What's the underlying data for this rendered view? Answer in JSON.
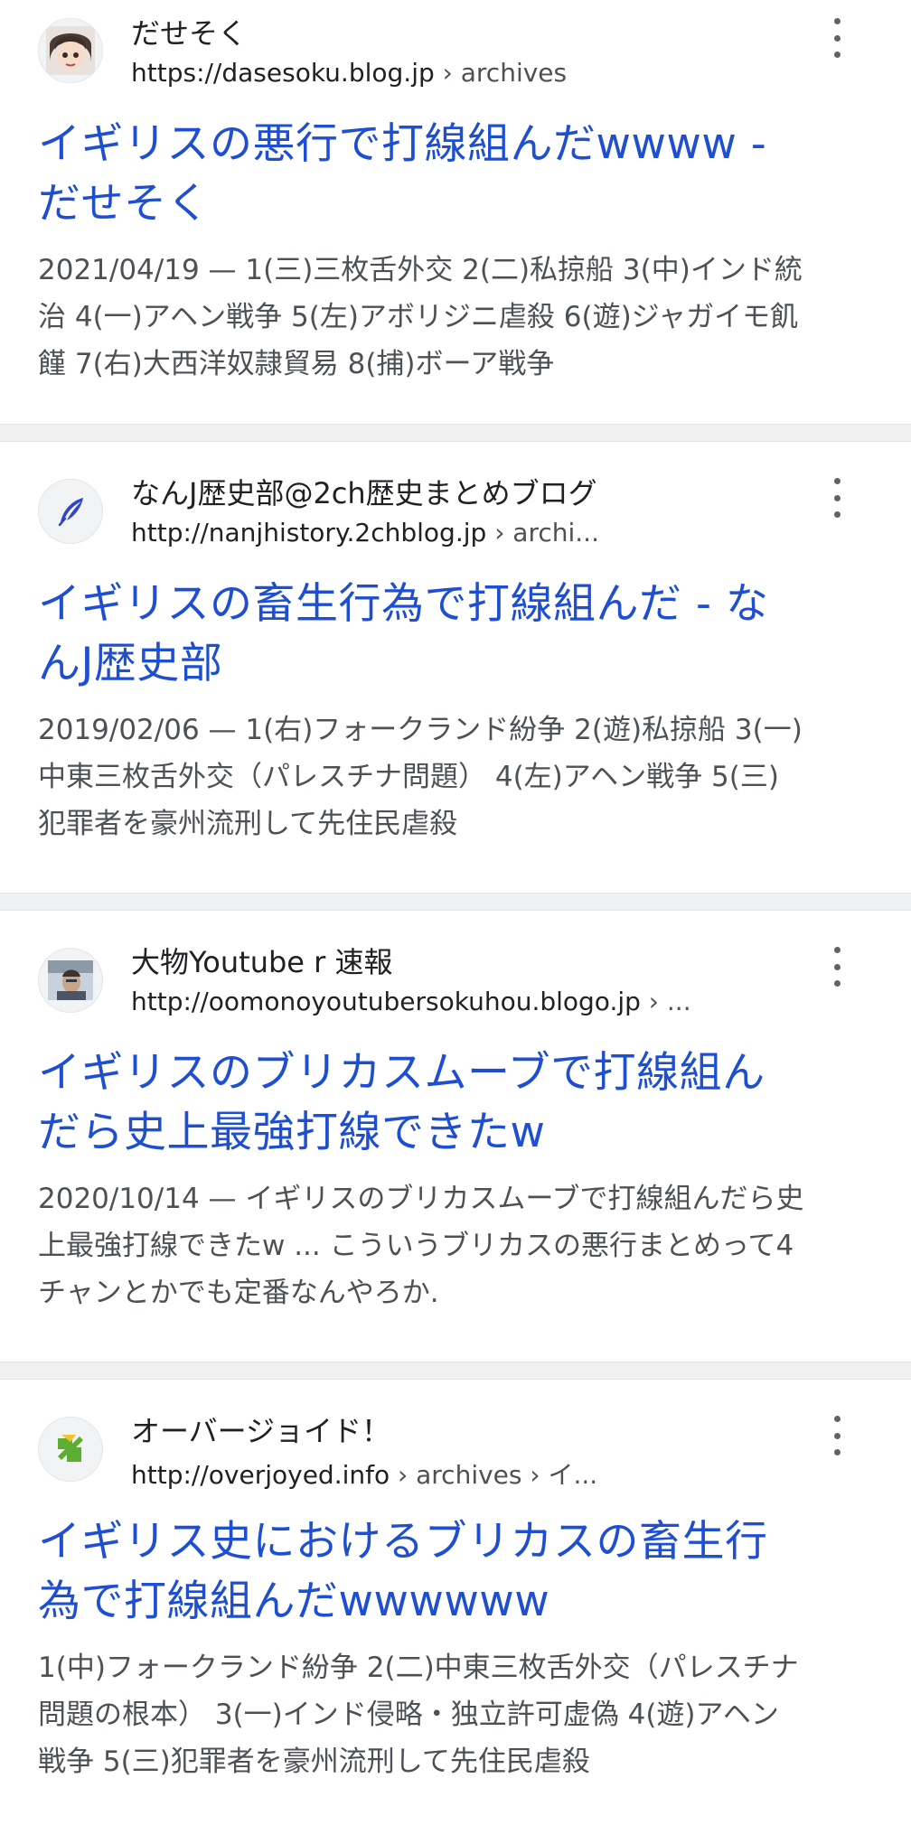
{
  "results": [
    {
      "site": "だせそく",
      "url_host": "https://dasesoku.blog.jp",
      "url_path": " › archives",
      "favicon": "anime-face-icon",
      "title_line1": "イギリスの悪行で打線組んだwwww -",
      "title_line2": "だせそく",
      "snippet_line1": "2021/04/19 — 1(三)三枚舌外交 2(二)私掠船 3(中)インド統",
      "snippet_line2": "治 4(一)アヘン戦争 5(左)アボリジニ虐殺 6(遊)ジャガイモ飢",
      "snippet_line3": "饉 7(右)大西洋奴隷貿易 8(捕)ボーア戦争"
    },
    {
      "site": "なんJ歴史部@2ch歴史まとめブログ",
      "url_host": "http://nanjhistory.2chblog.jp",
      "url_path": " › archi...",
      "favicon": "quill-icon",
      "title_line1": "イギリスの畜生行為で打線組んだ - な",
      "title_line2": "んJ歴史部",
      "snippet_line1": "2019/02/06 — 1(右)フォークランド紛争 2(遊)私掠船 3(一)",
      "snippet_line2": "中東三枚舌外交（パレスチナ問題） 4(左)アヘン戦争 5(三)",
      "snippet_line3": "犯罪者を豪州流刑して先住民虐殺"
    },
    {
      "site": "大物Youtube r 速報",
      "url_host": "http://oomonoyoutubersokuhou.blogo.jp",
      "url_path": " › ...",
      "favicon": "person-photo-icon",
      "title_line1": "イギリスのブリカスムーブで打線組ん",
      "title_line2": "だら史上最強打線できたw",
      "snippet_line1": "2020/10/14 — イギリスのブリカスムーブで打線組んだら史",
      "snippet_line2": "上最強打線できたw ... こういうブリカスの悪行まとめって4",
      "snippet_line3": "チャンとかでも定番なんやろか."
    },
    {
      "site": "オーバージョイド！",
      "url_host": "http://overjoyed.info",
      "url_path": " › archives › イ...",
      "favicon": "green-arrow-icon",
      "title_line1": "イギリス史におけるブリカスの畜生行",
      "title_line2": "為で打線組んだwwwwww",
      "snippet_line1": "1(中)フォークランド紛争 2(二)中東三枚舌外交（パレスチナ",
      "snippet_line2": "問題の根本） 3(一)インド侵略・独立許可虚偽 4(遊)アヘン",
      "snippet_line3": "戦争 5(三)犯罪者を豪州流刑して先住民虐殺"
    }
  ],
  "colors": {
    "title": "#1f4fd1",
    "snippet": "#4d5156",
    "separator": "#eef0f2"
  }
}
